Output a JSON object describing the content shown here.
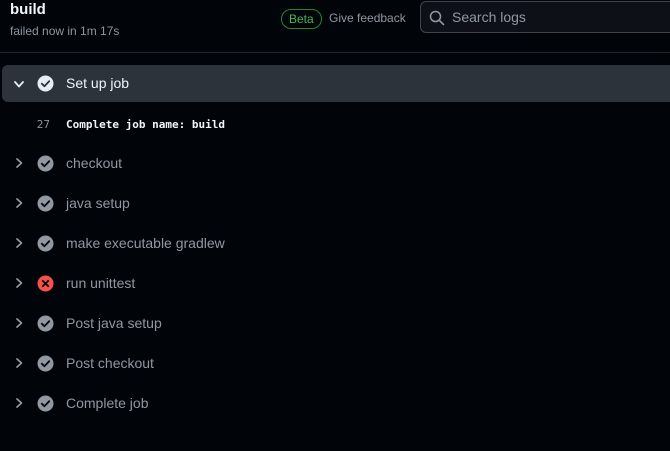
{
  "header": {
    "title": "build",
    "status": "failed now in 1m 17s",
    "beta_badge": "Beta",
    "feedback_link": "Give feedback",
    "search": {
      "placeholder": "Search logs",
      "value": ""
    }
  },
  "colors": {
    "background": "#010409",
    "expanded_row": "#2d333b",
    "success_icon": "#9198a1",
    "failure_icon": "#f85149",
    "beta_green": "#3fb950"
  },
  "steps": [
    {
      "label": "Set up job",
      "status": "success",
      "icon": "check-circle-icon",
      "expanded": true,
      "log": [
        {
          "line": "27",
          "text": "Complete job name: build"
        }
      ]
    },
    {
      "label": "checkout",
      "status": "success",
      "icon": "check-circle-icon",
      "expanded": false
    },
    {
      "label": "java setup",
      "status": "success",
      "icon": "check-circle-icon",
      "expanded": false
    },
    {
      "label": "make executable gradlew",
      "status": "success",
      "icon": "check-circle-icon",
      "expanded": false
    },
    {
      "label": "run unittest",
      "status": "failure",
      "icon": "x-circle-icon",
      "expanded": false
    },
    {
      "label": "Post java setup",
      "status": "success",
      "icon": "check-circle-icon",
      "expanded": false
    },
    {
      "label": "Post checkout",
      "status": "success",
      "icon": "check-circle-icon",
      "expanded": false
    },
    {
      "label": "Complete job",
      "status": "success",
      "icon": "check-circle-icon",
      "expanded": false
    }
  ]
}
